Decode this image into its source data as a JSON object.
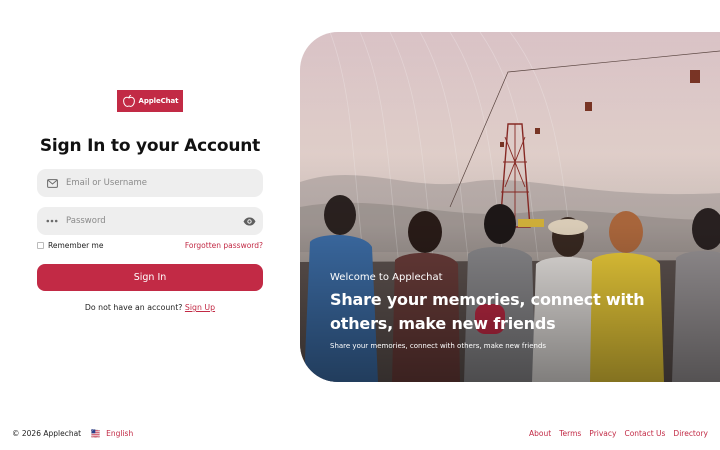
{
  "brand": {
    "logo_text": "AppleChat",
    "accent_color": "#c22a45"
  },
  "login": {
    "title": "Sign In to your Account",
    "email_placeholder": "Email or Username",
    "password_placeholder": "Password",
    "remember_label": "Remember me",
    "forgot_label": "Forgotten password?",
    "signin_label": "Sign In",
    "no_account_text": "Do not have an account?",
    "signup_label": "Sign Up"
  },
  "hero": {
    "welcome": "Welcome to Applechat",
    "headline": "Share your memories, connect with others, make new friends",
    "subtext": "Share your memories, connect with others, make new friends"
  },
  "footer": {
    "copyright": "© 2026 Applechat",
    "language": "English",
    "links": [
      "About",
      "Terms",
      "Privacy",
      "Contact Us",
      "Directory"
    ]
  },
  "icons": {
    "email": "mail-icon",
    "password": "password-dots-icon",
    "visibility": "eye-icon",
    "language": "us-flag-icon"
  }
}
